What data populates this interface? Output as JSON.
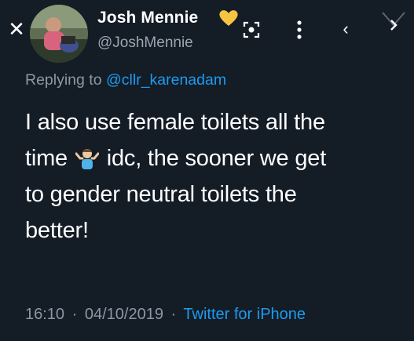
{
  "header": {
    "close_glyph": "✕",
    "display_name": "Josh Mennie",
    "handle": "@JoshMennie",
    "badge_icon": "yellow-heart-icon",
    "prev_glyph": "‹",
    "accent": "#1d9bf0",
    "badge_color": "#f5c542"
  },
  "reply": {
    "prefix": "Replying to",
    "mention": "@cllr_karenadam"
  },
  "tweet": {
    "line1": "I also use female toilets all the",
    "line2_before": "time",
    "emoji_icon": "man-shrugging-emoji-icon",
    "line2_after": "idc, the sooner we get",
    "line3": "to gender neutral toilets the",
    "line4": "better!"
  },
  "meta": {
    "time": "16:10",
    "date": "04/10/2019",
    "separator": "·",
    "source": "Twitter for iPhone"
  }
}
